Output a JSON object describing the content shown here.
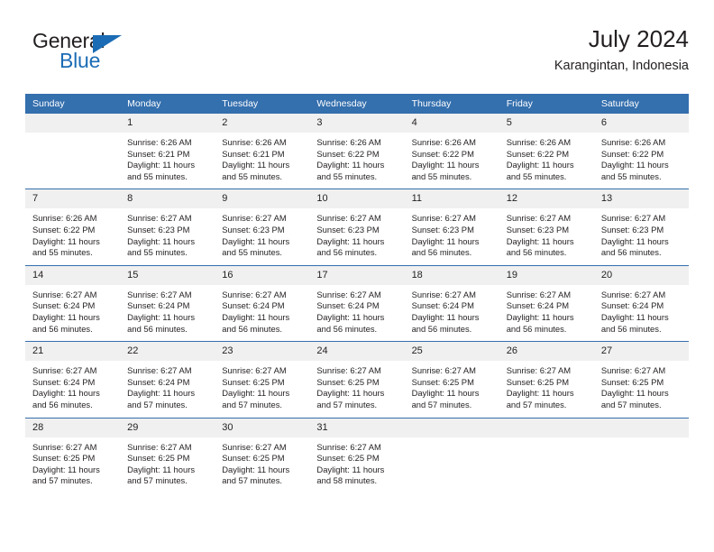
{
  "brand": {
    "name_part1": "General",
    "name_part2": "Blue",
    "logo_icon": "triangle-logo-icon",
    "accent_color": "#1b6cb5"
  },
  "header": {
    "title": "July 2024",
    "subtitle": "Karangintan, Indonesia"
  },
  "theme": {
    "header_bg": "#346FAE",
    "daynum_bg": "#f0f0f0",
    "text_color": "#231f20"
  },
  "calendar": {
    "weekday_headers": [
      "Sunday",
      "Monday",
      "Tuesday",
      "Wednesday",
      "Thursday",
      "Friday",
      "Saturday"
    ],
    "weeks": [
      [
        {
          "day": "",
          "sunrise": "",
          "sunset": "",
          "daylight_line1": "",
          "daylight_line2": "",
          "empty": true
        },
        {
          "day": "1",
          "sunrise": "Sunrise: 6:26 AM",
          "sunset": "Sunset: 6:21 PM",
          "daylight_line1": "Daylight: 11 hours",
          "daylight_line2": "and 55 minutes."
        },
        {
          "day": "2",
          "sunrise": "Sunrise: 6:26 AM",
          "sunset": "Sunset: 6:21 PM",
          "daylight_line1": "Daylight: 11 hours",
          "daylight_line2": "and 55 minutes."
        },
        {
          "day": "3",
          "sunrise": "Sunrise: 6:26 AM",
          "sunset": "Sunset: 6:22 PM",
          "daylight_line1": "Daylight: 11 hours",
          "daylight_line2": "and 55 minutes."
        },
        {
          "day": "4",
          "sunrise": "Sunrise: 6:26 AM",
          "sunset": "Sunset: 6:22 PM",
          "daylight_line1": "Daylight: 11 hours",
          "daylight_line2": "and 55 minutes."
        },
        {
          "day": "5",
          "sunrise": "Sunrise: 6:26 AM",
          "sunset": "Sunset: 6:22 PM",
          "daylight_line1": "Daylight: 11 hours",
          "daylight_line2": "and 55 minutes."
        },
        {
          "day": "6",
          "sunrise": "Sunrise: 6:26 AM",
          "sunset": "Sunset: 6:22 PM",
          "daylight_line1": "Daylight: 11 hours",
          "daylight_line2": "and 55 minutes."
        }
      ],
      [
        {
          "day": "7",
          "sunrise": "Sunrise: 6:26 AM",
          "sunset": "Sunset: 6:22 PM",
          "daylight_line1": "Daylight: 11 hours",
          "daylight_line2": "and 55 minutes."
        },
        {
          "day": "8",
          "sunrise": "Sunrise: 6:27 AM",
          "sunset": "Sunset: 6:23 PM",
          "daylight_line1": "Daylight: 11 hours",
          "daylight_line2": "and 55 minutes."
        },
        {
          "day": "9",
          "sunrise": "Sunrise: 6:27 AM",
          "sunset": "Sunset: 6:23 PM",
          "daylight_line1": "Daylight: 11 hours",
          "daylight_line2": "and 55 minutes."
        },
        {
          "day": "10",
          "sunrise": "Sunrise: 6:27 AM",
          "sunset": "Sunset: 6:23 PM",
          "daylight_line1": "Daylight: 11 hours",
          "daylight_line2": "and 56 minutes."
        },
        {
          "day": "11",
          "sunrise": "Sunrise: 6:27 AM",
          "sunset": "Sunset: 6:23 PM",
          "daylight_line1": "Daylight: 11 hours",
          "daylight_line2": "and 56 minutes."
        },
        {
          "day": "12",
          "sunrise": "Sunrise: 6:27 AM",
          "sunset": "Sunset: 6:23 PM",
          "daylight_line1": "Daylight: 11 hours",
          "daylight_line2": "and 56 minutes."
        },
        {
          "day": "13",
          "sunrise": "Sunrise: 6:27 AM",
          "sunset": "Sunset: 6:23 PM",
          "daylight_line1": "Daylight: 11 hours",
          "daylight_line2": "and 56 minutes."
        }
      ],
      [
        {
          "day": "14",
          "sunrise": "Sunrise: 6:27 AM",
          "sunset": "Sunset: 6:24 PM",
          "daylight_line1": "Daylight: 11 hours",
          "daylight_line2": "and 56 minutes."
        },
        {
          "day": "15",
          "sunrise": "Sunrise: 6:27 AM",
          "sunset": "Sunset: 6:24 PM",
          "daylight_line1": "Daylight: 11 hours",
          "daylight_line2": "and 56 minutes."
        },
        {
          "day": "16",
          "sunrise": "Sunrise: 6:27 AM",
          "sunset": "Sunset: 6:24 PM",
          "daylight_line1": "Daylight: 11 hours",
          "daylight_line2": "and 56 minutes."
        },
        {
          "day": "17",
          "sunrise": "Sunrise: 6:27 AM",
          "sunset": "Sunset: 6:24 PM",
          "daylight_line1": "Daylight: 11 hours",
          "daylight_line2": "and 56 minutes."
        },
        {
          "day": "18",
          "sunrise": "Sunrise: 6:27 AM",
          "sunset": "Sunset: 6:24 PM",
          "daylight_line1": "Daylight: 11 hours",
          "daylight_line2": "and 56 minutes."
        },
        {
          "day": "19",
          "sunrise": "Sunrise: 6:27 AM",
          "sunset": "Sunset: 6:24 PM",
          "daylight_line1": "Daylight: 11 hours",
          "daylight_line2": "and 56 minutes."
        },
        {
          "day": "20",
          "sunrise": "Sunrise: 6:27 AM",
          "sunset": "Sunset: 6:24 PM",
          "daylight_line1": "Daylight: 11 hours",
          "daylight_line2": "and 56 minutes."
        }
      ],
      [
        {
          "day": "21",
          "sunrise": "Sunrise: 6:27 AM",
          "sunset": "Sunset: 6:24 PM",
          "daylight_line1": "Daylight: 11 hours",
          "daylight_line2": "and 56 minutes."
        },
        {
          "day": "22",
          "sunrise": "Sunrise: 6:27 AM",
          "sunset": "Sunset: 6:24 PM",
          "daylight_line1": "Daylight: 11 hours",
          "daylight_line2": "and 57 minutes."
        },
        {
          "day": "23",
          "sunrise": "Sunrise: 6:27 AM",
          "sunset": "Sunset: 6:25 PM",
          "daylight_line1": "Daylight: 11 hours",
          "daylight_line2": "and 57 minutes."
        },
        {
          "day": "24",
          "sunrise": "Sunrise: 6:27 AM",
          "sunset": "Sunset: 6:25 PM",
          "daylight_line1": "Daylight: 11 hours",
          "daylight_line2": "and 57 minutes."
        },
        {
          "day": "25",
          "sunrise": "Sunrise: 6:27 AM",
          "sunset": "Sunset: 6:25 PM",
          "daylight_line1": "Daylight: 11 hours",
          "daylight_line2": "and 57 minutes."
        },
        {
          "day": "26",
          "sunrise": "Sunrise: 6:27 AM",
          "sunset": "Sunset: 6:25 PM",
          "daylight_line1": "Daylight: 11 hours",
          "daylight_line2": "and 57 minutes."
        },
        {
          "day": "27",
          "sunrise": "Sunrise: 6:27 AM",
          "sunset": "Sunset: 6:25 PM",
          "daylight_line1": "Daylight: 11 hours",
          "daylight_line2": "and 57 minutes."
        }
      ],
      [
        {
          "day": "28",
          "sunrise": "Sunrise: 6:27 AM",
          "sunset": "Sunset: 6:25 PM",
          "daylight_line1": "Daylight: 11 hours",
          "daylight_line2": "and 57 minutes."
        },
        {
          "day": "29",
          "sunrise": "Sunrise: 6:27 AM",
          "sunset": "Sunset: 6:25 PM",
          "daylight_line1": "Daylight: 11 hours",
          "daylight_line2": "and 57 minutes."
        },
        {
          "day": "30",
          "sunrise": "Sunrise: 6:27 AM",
          "sunset": "Sunset: 6:25 PM",
          "daylight_line1": "Daylight: 11 hours",
          "daylight_line2": "and 57 minutes."
        },
        {
          "day": "31",
          "sunrise": "Sunrise: 6:27 AM",
          "sunset": "Sunset: 6:25 PM",
          "daylight_line1": "Daylight: 11 hours",
          "daylight_line2": "and 58 minutes."
        },
        {
          "day": "",
          "sunrise": "",
          "sunset": "",
          "daylight_line1": "",
          "daylight_line2": "",
          "empty": true
        },
        {
          "day": "",
          "sunrise": "",
          "sunset": "",
          "daylight_line1": "",
          "daylight_line2": "",
          "empty": true
        },
        {
          "day": "",
          "sunrise": "",
          "sunset": "",
          "daylight_line1": "",
          "daylight_line2": "",
          "empty": true
        }
      ]
    ]
  }
}
